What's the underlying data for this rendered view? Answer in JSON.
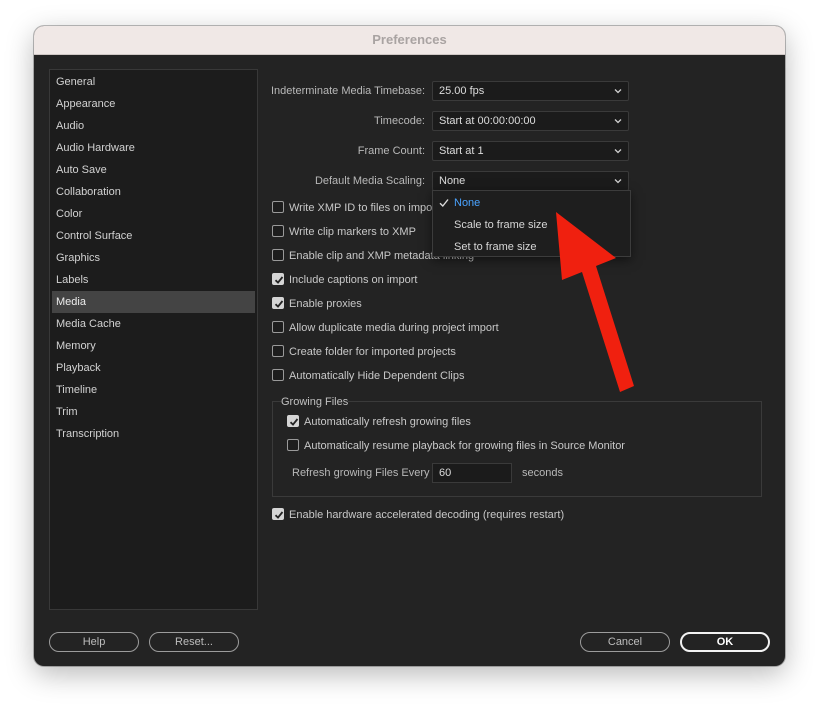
{
  "window": {
    "title": "Preferences"
  },
  "sidebar": {
    "items": [
      {
        "label": "General"
      },
      {
        "label": "Appearance"
      },
      {
        "label": "Audio"
      },
      {
        "label": "Audio Hardware"
      },
      {
        "label": "Auto Save"
      },
      {
        "label": "Collaboration"
      },
      {
        "label": "Color"
      },
      {
        "label": "Control Surface"
      },
      {
        "label": "Graphics"
      },
      {
        "label": "Labels"
      },
      {
        "label": "Media"
      },
      {
        "label": "Media Cache"
      },
      {
        "label": "Memory"
      },
      {
        "label": "Playback"
      },
      {
        "label": "Timeline"
      },
      {
        "label": "Trim"
      },
      {
        "label": "Transcription"
      }
    ],
    "selected": "Media"
  },
  "fields": {
    "timebase": {
      "label": "Indeterminate Media Timebase:",
      "value": "25.00 fps"
    },
    "timecode": {
      "label": "Timecode:",
      "value": "Start at 00:00:00:00"
    },
    "frame_count": {
      "label": "Frame Count:",
      "value": "Start at 1"
    },
    "scaling": {
      "label": "Default Media Scaling:",
      "value": "None"
    }
  },
  "scaling_dropdown": {
    "options": [
      {
        "label": "None",
        "selected": true
      },
      {
        "label": "Scale to frame size",
        "selected": false
      },
      {
        "label": "Set to frame size",
        "selected": false
      }
    ]
  },
  "checkboxes": [
    {
      "label": "Write XMP ID to files on impo",
      "checked": false
    },
    {
      "label": "Write clip markers to XMP",
      "checked": false
    },
    {
      "label": "Enable clip and XMP metadata linking",
      "checked": false
    },
    {
      "label": "Include captions on import",
      "checked": true
    },
    {
      "label": "Enable proxies",
      "checked": true
    },
    {
      "label": "Allow duplicate media during project import",
      "checked": false
    },
    {
      "label": "Create folder for imported projects",
      "checked": false
    },
    {
      "label": "Automatically Hide Dependent Clips",
      "checked": false
    }
  ],
  "growing_files": {
    "title": "Growing Files",
    "auto_refresh": {
      "label": "Automatically refresh growing files",
      "checked": true
    },
    "auto_resume": {
      "label": "Automatically resume playback for growing files in Source Monitor",
      "checked": false
    },
    "refresh_label": "Refresh growing Files Every",
    "refresh_value": "60",
    "refresh_unit": "seconds"
  },
  "hw_decoding": {
    "label": "Enable hardware accelerated decoding (requires restart)",
    "checked": true
  },
  "buttons": {
    "help": "Help",
    "reset": "Reset...",
    "cancel": "Cancel",
    "ok": "OK"
  },
  "colors": {
    "annotation_arrow": "#f0200f",
    "selected_option": "#4aa3ff"
  }
}
